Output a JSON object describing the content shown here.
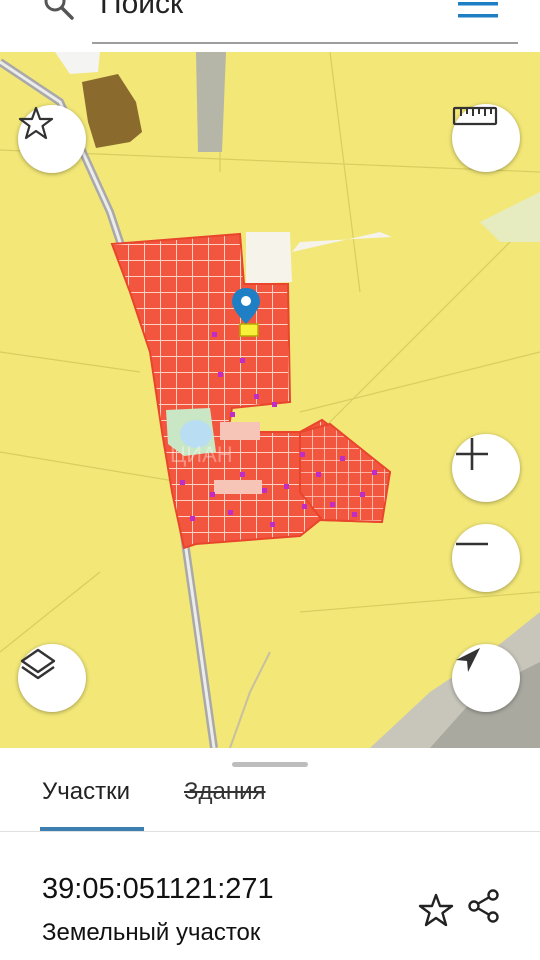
{
  "search": {
    "placeholder": "Поиск"
  },
  "map": {
    "land_color": "#f2e777",
    "parcel_color": "#f2563e",
    "marker_color": "#1f7fc4"
  },
  "tabs": [
    {
      "label": "Участки",
      "active": true
    },
    {
      "label": "Здания",
      "active": false
    }
  ],
  "parcel": {
    "cadastral_number": "39:05:051121:271",
    "type": "Земельный участок"
  },
  "icons": {
    "search": "search-icon",
    "menu": "menu-icon",
    "favorite": "star-icon",
    "ruler": "ruler-icon",
    "zoom_in": "plus-icon",
    "zoom_out": "minus-icon",
    "layers": "layers-icon",
    "locate": "navigation-arrow-icon",
    "share": "share-icon"
  }
}
